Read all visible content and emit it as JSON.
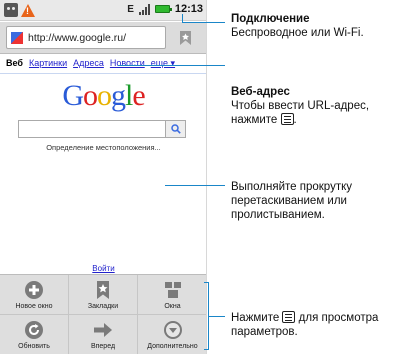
{
  "status_bar": {
    "time": "12:13",
    "network": "E"
  },
  "browser": {
    "url": "http://www.google.ru/",
    "nav": {
      "active": "Веб",
      "links": [
        "Картинки",
        "Адреса",
        "Новости",
        "еще ▾"
      ]
    },
    "logo_text": "Google",
    "search_placeholder": "",
    "location_text": "Определение местоположения...",
    "login_link": "Войти"
  },
  "menu": {
    "items": [
      {
        "label": "Новое окно",
        "icon": "plus-circle-icon"
      },
      {
        "label": "Закладки",
        "icon": "bookmark-star-icon"
      },
      {
        "label": "Окна",
        "icon": "windows-icon"
      },
      {
        "label": "Обновить",
        "icon": "refresh-icon"
      },
      {
        "label": "Вперед",
        "icon": "forward-arrow-icon"
      },
      {
        "label": "Дополнительно",
        "icon": "more-chevron-icon"
      }
    ]
  },
  "callouts": {
    "connection": {
      "title": "Подключение",
      "text": "Беспроводное или Wi-Fi."
    },
    "address": {
      "title": "Веб-адрес",
      "text_before": "Чтобы ввести URL-адрес,",
      "text_after": "нажмите",
      "text_end": "."
    },
    "scroll": {
      "line1": "Выполняйте прокрутку",
      "line2": "перетаскиванием или",
      "line3": "пролистыванием."
    },
    "menu": {
      "line1_before": "Нажмите",
      "line1_after": "для просмотра",
      "line2": "параметров."
    }
  },
  "colors": {
    "callout_line": "#1a86c8",
    "link": "#2222cc",
    "battery": "#2fb92f",
    "warning": "#e8641a"
  }
}
